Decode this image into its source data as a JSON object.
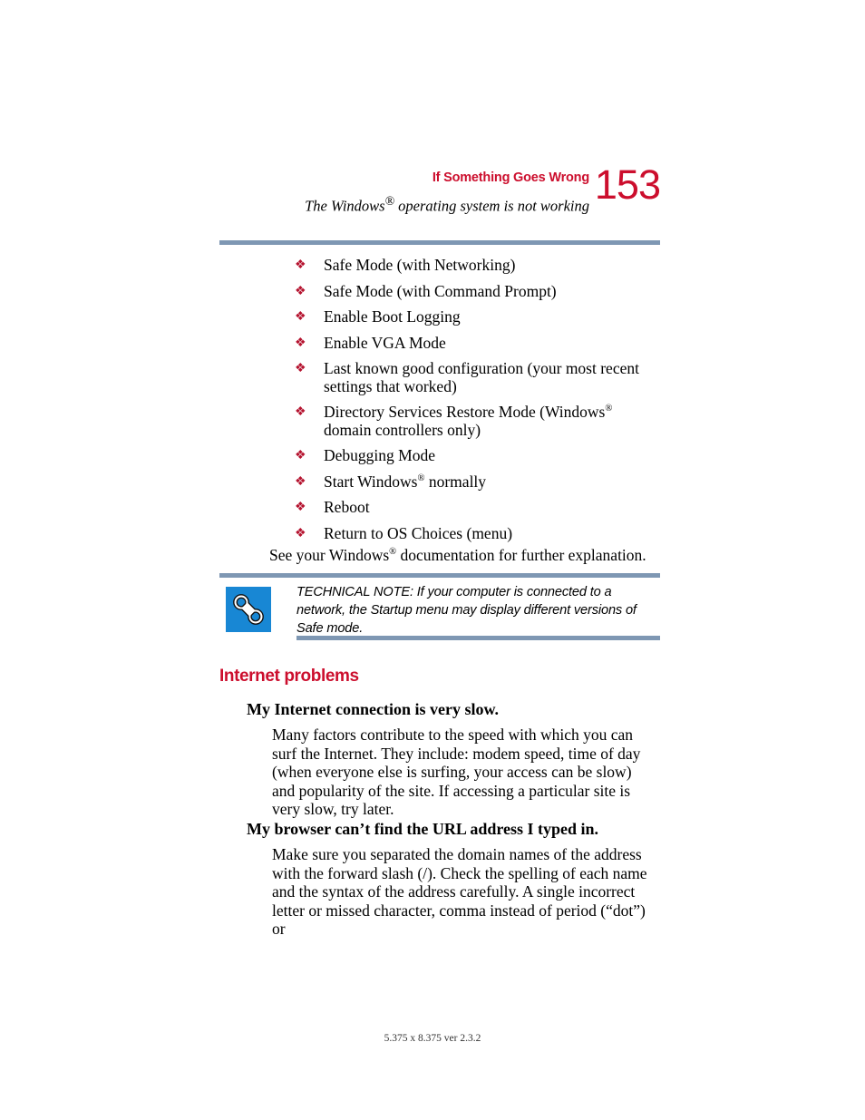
{
  "header": {
    "chapter_title": "If Something Goes Wrong",
    "section_subtitle": "The Windows® operating system is not working",
    "page_number": "153",
    "accent_red": "#CC0E2D",
    "rule_blue": "#7E97B3"
  },
  "bullets": [
    "Safe Mode (with Networking)",
    "Safe Mode (with Command Prompt)",
    "Enable Boot Logging",
    "Enable VGA Mode",
    "Last known good configuration (your most recent settings that worked)",
    "Directory Services Restore Mode (Windows® domain controllers only)",
    "Debugging Mode",
    "Start Windows® normally",
    "Reboot",
    "Return to OS Choices (menu)"
  ],
  "bullet_glyph": "❖",
  "see_also": "See your Windows® documentation for further explanation.",
  "technical_note": {
    "icon_name": "wrench-icon",
    "icon_background": "#1887D4",
    "text": "TECHNICAL NOTE: If your computer is connected to a network, the Startup menu may display different versions of Safe mode."
  },
  "section": {
    "heading": "Internet problems",
    "items": [
      {
        "question": "My Internet connection is very slow.",
        "answer": "Many factors contribute to the speed with which you can surf the Internet. They include: modem speed, time of day (when everyone else is surfing, your access can be slow) and popularity of the site. If accessing a particular site is very slow, try later."
      },
      {
        "question": "My browser can’t find the URL address I typed in.",
        "answer": "Make sure you separated the domain names of the address with the forward slash (/). Check the spelling of each name and the syntax of the address carefully. A single incorrect letter or missed character, comma instead of period (“dot”) or"
      }
    ]
  },
  "footer": {
    "text": "5.375 x 8.375 ver 2.3.2"
  }
}
